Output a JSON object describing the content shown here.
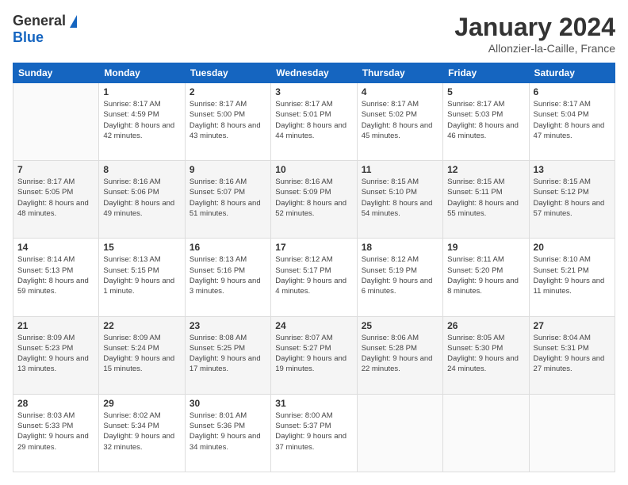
{
  "header": {
    "logo_general": "General",
    "logo_blue": "Blue",
    "month_title": "January 2024",
    "location": "Allonzier-la-Caille, France"
  },
  "days_of_week": [
    "Sunday",
    "Monday",
    "Tuesday",
    "Wednesday",
    "Thursday",
    "Friday",
    "Saturday"
  ],
  "weeks": [
    {
      "days": [
        {
          "number": "",
          "sunrise": "",
          "sunset": "",
          "daylight": "",
          "empty": true
        },
        {
          "number": "1",
          "sunrise": "Sunrise: 8:17 AM",
          "sunset": "Sunset: 4:59 PM",
          "daylight": "Daylight: 8 hours and 42 minutes."
        },
        {
          "number": "2",
          "sunrise": "Sunrise: 8:17 AM",
          "sunset": "Sunset: 5:00 PM",
          "daylight": "Daylight: 8 hours and 43 minutes."
        },
        {
          "number": "3",
          "sunrise": "Sunrise: 8:17 AM",
          "sunset": "Sunset: 5:01 PM",
          "daylight": "Daylight: 8 hours and 44 minutes."
        },
        {
          "number": "4",
          "sunrise": "Sunrise: 8:17 AM",
          "sunset": "Sunset: 5:02 PM",
          "daylight": "Daylight: 8 hours and 45 minutes."
        },
        {
          "number": "5",
          "sunrise": "Sunrise: 8:17 AM",
          "sunset": "Sunset: 5:03 PM",
          "daylight": "Daylight: 8 hours and 46 minutes."
        },
        {
          "number": "6",
          "sunrise": "Sunrise: 8:17 AM",
          "sunset": "Sunset: 5:04 PM",
          "daylight": "Daylight: 8 hours and 47 minutes."
        }
      ]
    },
    {
      "days": [
        {
          "number": "7",
          "sunrise": "Sunrise: 8:17 AM",
          "sunset": "Sunset: 5:05 PM",
          "daylight": "Daylight: 8 hours and 48 minutes."
        },
        {
          "number": "8",
          "sunrise": "Sunrise: 8:16 AM",
          "sunset": "Sunset: 5:06 PM",
          "daylight": "Daylight: 8 hours and 49 minutes."
        },
        {
          "number": "9",
          "sunrise": "Sunrise: 8:16 AM",
          "sunset": "Sunset: 5:07 PM",
          "daylight": "Daylight: 8 hours and 51 minutes."
        },
        {
          "number": "10",
          "sunrise": "Sunrise: 8:16 AM",
          "sunset": "Sunset: 5:09 PM",
          "daylight": "Daylight: 8 hours and 52 minutes."
        },
        {
          "number": "11",
          "sunrise": "Sunrise: 8:15 AM",
          "sunset": "Sunset: 5:10 PM",
          "daylight": "Daylight: 8 hours and 54 minutes."
        },
        {
          "number": "12",
          "sunrise": "Sunrise: 8:15 AM",
          "sunset": "Sunset: 5:11 PM",
          "daylight": "Daylight: 8 hours and 55 minutes."
        },
        {
          "number": "13",
          "sunrise": "Sunrise: 8:15 AM",
          "sunset": "Sunset: 5:12 PM",
          "daylight": "Daylight: 8 hours and 57 minutes."
        }
      ]
    },
    {
      "days": [
        {
          "number": "14",
          "sunrise": "Sunrise: 8:14 AM",
          "sunset": "Sunset: 5:13 PM",
          "daylight": "Daylight: 8 hours and 59 minutes."
        },
        {
          "number": "15",
          "sunrise": "Sunrise: 8:13 AM",
          "sunset": "Sunset: 5:15 PM",
          "daylight": "Daylight: 9 hours and 1 minute."
        },
        {
          "number": "16",
          "sunrise": "Sunrise: 8:13 AM",
          "sunset": "Sunset: 5:16 PM",
          "daylight": "Daylight: 9 hours and 3 minutes."
        },
        {
          "number": "17",
          "sunrise": "Sunrise: 8:12 AM",
          "sunset": "Sunset: 5:17 PM",
          "daylight": "Daylight: 9 hours and 4 minutes."
        },
        {
          "number": "18",
          "sunrise": "Sunrise: 8:12 AM",
          "sunset": "Sunset: 5:19 PM",
          "daylight": "Daylight: 9 hours and 6 minutes."
        },
        {
          "number": "19",
          "sunrise": "Sunrise: 8:11 AM",
          "sunset": "Sunset: 5:20 PM",
          "daylight": "Daylight: 9 hours and 8 minutes."
        },
        {
          "number": "20",
          "sunrise": "Sunrise: 8:10 AM",
          "sunset": "Sunset: 5:21 PM",
          "daylight": "Daylight: 9 hours and 11 minutes."
        }
      ]
    },
    {
      "days": [
        {
          "number": "21",
          "sunrise": "Sunrise: 8:09 AM",
          "sunset": "Sunset: 5:23 PM",
          "daylight": "Daylight: 9 hours and 13 minutes."
        },
        {
          "number": "22",
          "sunrise": "Sunrise: 8:09 AM",
          "sunset": "Sunset: 5:24 PM",
          "daylight": "Daylight: 9 hours and 15 minutes."
        },
        {
          "number": "23",
          "sunrise": "Sunrise: 8:08 AM",
          "sunset": "Sunset: 5:25 PM",
          "daylight": "Daylight: 9 hours and 17 minutes."
        },
        {
          "number": "24",
          "sunrise": "Sunrise: 8:07 AM",
          "sunset": "Sunset: 5:27 PM",
          "daylight": "Daylight: 9 hours and 19 minutes."
        },
        {
          "number": "25",
          "sunrise": "Sunrise: 8:06 AM",
          "sunset": "Sunset: 5:28 PM",
          "daylight": "Daylight: 9 hours and 22 minutes."
        },
        {
          "number": "26",
          "sunrise": "Sunrise: 8:05 AM",
          "sunset": "Sunset: 5:30 PM",
          "daylight": "Daylight: 9 hours and 24 minutes."
        },
        {
          "number": "27",
          "sunrise": "Sunrise: 8:04 AM",
          "sunset": "Sunset: 5:31 PM",
          "daylight": "Daylight: 9 hours and 27 minutes."
        }
      ]
    },
    {
      "days": [
        {
          "number": "28",
          "sunrise": "Sunrise: 8:03 AM",
          "sunset": "Sunset: 5:33 PM",
          "daylight": "Daylight: 9 hours and 29 minutes."
        },
        {
          "number": "29",
          "sunrise": "Sunrise: 8:02 AM",
          "sunset": "Sunset: 5:34 PM",
          "daylight": "Daylight: 9 hours and 32 minutes."
        },
        {
          "number": "30",
          "sunrise": "Sunrise: 8:01 AM",
          "sunset": "Sunset: 5:36 PM",
          "daylight": "Daylight: 9 hours and 34 minutes."
        },
        {
          "number": "31",
          "sunrise": "Sunrise: 8:00 AM",
          "sunset": "Sunset: 5:37 PM",
          "daylight": "Daylight: 9 hours and 37 minutes."
        },
        {
          "number": "",
          "sunrise": "",
          "sunset": "",
          "daylight": "",
          "empty": true
        },
        {
          "number": "",
          "sunrise": "",
          "sunset": "",
          "daylight": "",
          "empty": true
        },
        {
          "number": "",
          "sunrise": "",
          "sunset": "",
          "daylight": "",
          "empty": true
        }
      ]
    }
  ]
}
